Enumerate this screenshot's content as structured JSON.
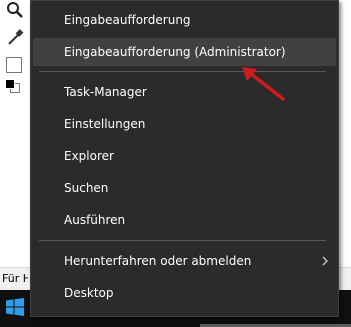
{
  "background_app": {
    "tools": [
      "magnifier-icon",
      "color-picker-icon"
    ],
    "status_text": "Für H"
  },
  "menu": {
    "items": [
      {
        "label": "Eingabeaufforderung"
      },
      {
        "label": "Eingabeaufforderung (Administrator)"
      },
      {
        "label": "Task-Manager"
      },
      {
        "label": "Einstellungen"
      },
      {
        "label": "Explorer"
      },
      {
        "label": "Suchen"
      },
      {
        "label": "Ausführen"
      },
      {
        "label": "Herunterfahren oder abmelden",
        "submenu_icon": "chevron-right-icon"
      },
      {
        "label": "Desktop"
      }
    ],
    "hovered_item": "Eingabeaufforderung (Administrator)"
  },
  "annotation": {
    "icon": "red-arrow-icon",
    "color": "#d11a1a"
  },
  "colors": {
    "menu_bg": "#2b2b2b",
    "menu_hover": "#414141",
    "menu_text": "#ffffff",
    "taskbar": "#101010",
    "windows_logo": "#2f9ee8"
  },
  "taskbar": {
    "start_icon": "windows-logo-icon"
  }
}
